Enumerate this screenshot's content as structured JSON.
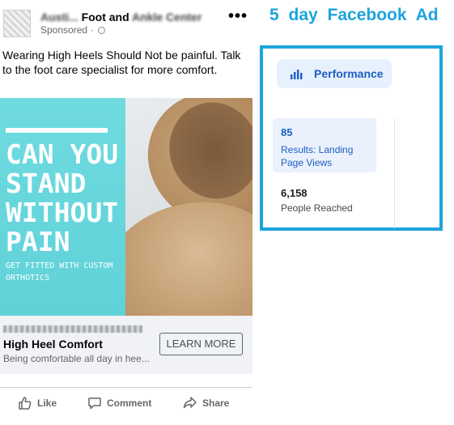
{
  "post": {
    "page_name_visible": "Foot and",
    "page_name_blurred_prefix": "Austi...",
    "page_name_blurred_suffix": "Ankle Center",
    "sponsored": "Sponsored ·",
    "more_icon": "ellipsis-icon",
    "text": "Wearing High Heels Should Not be painful. Talk to the foot care specialist for more comfort.",
    "image": {
      "headline": "CAN YOU STAND WITHOUT PAIN",
      "subline": "GET FITTED WITH CUSTOM ORTHOTICS",
      "panel_color": "#63d5db"
    },
    "link": {
      "title": "High Heel Comfort",
      "description": "Being comfortable all day in hee...",
      "cta": "LEARN MORE"
    },
    "actions": {
      "like": "Like",
      "comment": "Comment",
      "share": "Share"
    }
  },
  "annotation": {
    "title": "5 day Facebook Ad",
    "color": "#1ea4dc"
  },
  "performance": {
    "tab_label": "Performance",
    "results_value": "85",
    "results_label": "Results: Landing Page Views",
    "reach_value": "6,158",
    "reach_label": "People Reached",
    "accent": "#1b5fc2"
  }
}
